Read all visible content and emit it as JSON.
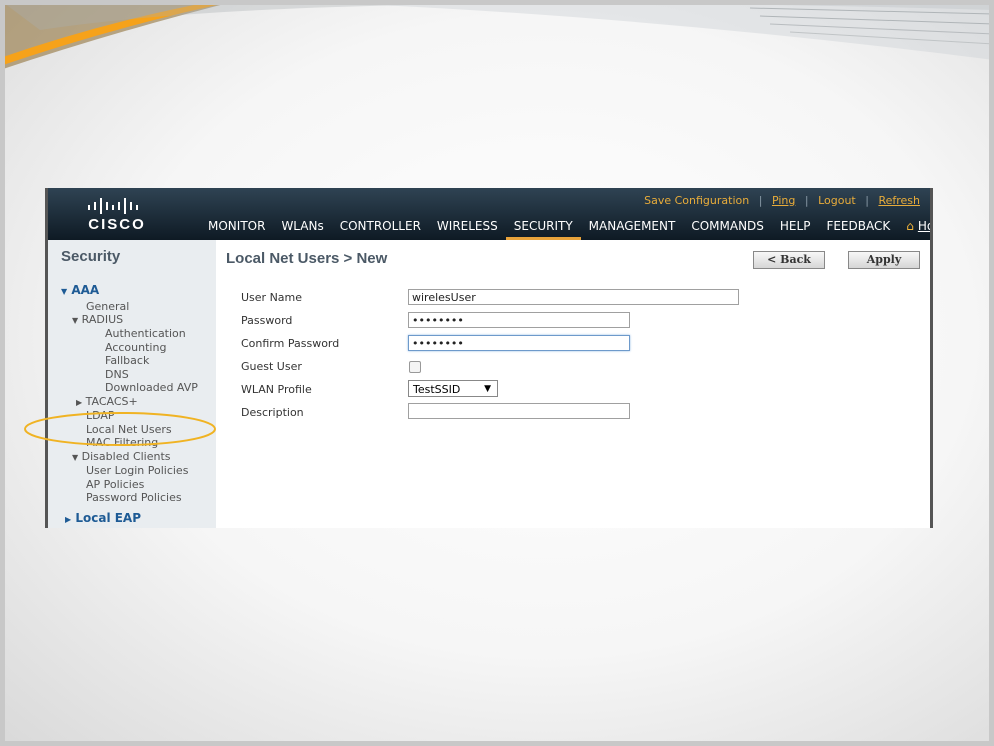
{
  "header": {
    "logo_text": "CISCO",
    "utility_links": [
      "Save Configuration",
      "Ping",
      "Logout",
      "Refresh"
    ],
    "nav": [
      "MONITOR",
      "WLANs",
      "CONTROLLER",
      "WIRELESS",
      "SECURITY",
      "MANAGEMENT",
      "COMMANDS",
      "HELP",
      "FEEDBACK",
      "Home"
    ],
    "active_nav": "SECURITY"
  },
  "sidebar": {
    "title": "Security",
    "items": [
      "AAA",
      "General",
      "RADIUS",
      "Authentication",
      "Accounting",
      "Fallback",
      "DNS",
      "Downloaded AVP",
      "TACACS+",
      "LDAP",
      "Local Net Users",
      "MAC Filtering",
      "Disabled Clients",
      "User Login Policies",
      "AP Policies",
      "Password Policies",
      "Local EAP"
    ],
    "highlighted_item": "Local Net Users"
  },
  "main": {
    "title": "Local Net Users > New",
    "back_label": "< Back",
    "apply_label": "Apply",
    "fields": [
      {
        "label": "User Name",
        "value": "wirelesUser"
      },
      {
        "label": "Password",
        "value": "••••••••"
      },
      {
        "label": "Confirm Password",
        "value": "••••••••"
      },
      {
        "label": "Guest User",
        "checked": false
      },
      {
        "label": "WLAN Profile",
        "value": "TestSSID"
      },
      {
        "label": "Description",
        "value": ""
      }
    ]
  },
  "colors": {
    "accent_orange": "#e8a33b",
    "header_dark": "#0e1a24",
    "annotation": "#f0b323"
  }
}
